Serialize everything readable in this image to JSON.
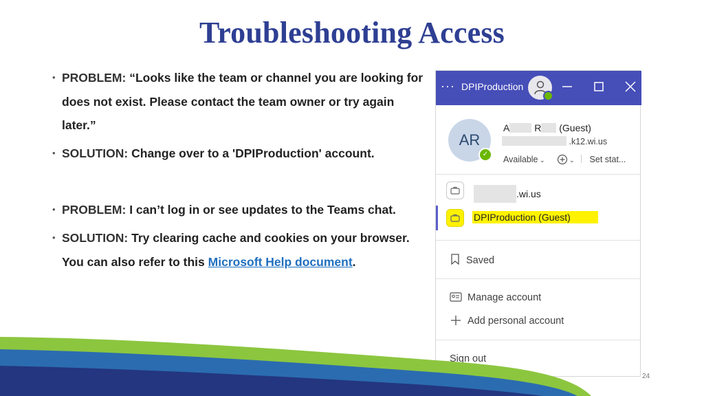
{
  "slide": {
    "title": "Troubleshooting Access",
    "page_number": "24"
  },
  "bullets": [
    {
      "label": "PROBLEM:",
      "text": "“Looks like the team or channel you are looking for does not exist. Please contact the team owner or try again later.”"
    },
    {
      "label": "SOLUTION:",
      "text": "Change over to a 'DPIProduction' account."
    },
    {
      "label": "PROBLEM:",
      "text": "I can’t log in or see updates to the Teams chat."
    },
    {
      "label": "SOLUTION:",
      "text": "Try clearing cache and cookies on your browser. You can also refer to this",
      "link_text": "Microsoft Help document",
      "after_link": "."
    }
  ],
  "teams_panel": {
    "titlebar": {
      "more_icon": "ellipsis-icon",
      "account_name": "DPIProduction"
    },
    "profile": {
      "initials": "AR",
      "name_part1": "A",
      "name_part2": "R",
      "guest_tag": "(Guest)",
      "email_domain": ".k12.wi.us",
      "status": "Available",
      "set_status": "Set stat..."
    },
    "accounts": [
      {
        "label": ".wi.us",
        "active": false
      },
      {
        "label": "DPIProduction (Guest)",
        "active": true
      }
    ],
    "menu": {
      "saved": "Saved",
      "manage_account": "Manage account",
      "add_personal_account": "Add personal account",
      "sign_out": "Sign out"
    }
  },
  "colors": {
    "title": "#2e3f93",
    "titlebar": "#464eb8",
    "highlight": "#fff200",
    "link": "#1f6fbf",
    "status_green": "#6bb700",
    "band_green": "#8cc63f",
    "band_blue": "#2b6cb0",
    "band_navy": "#23367f"
  }
}
